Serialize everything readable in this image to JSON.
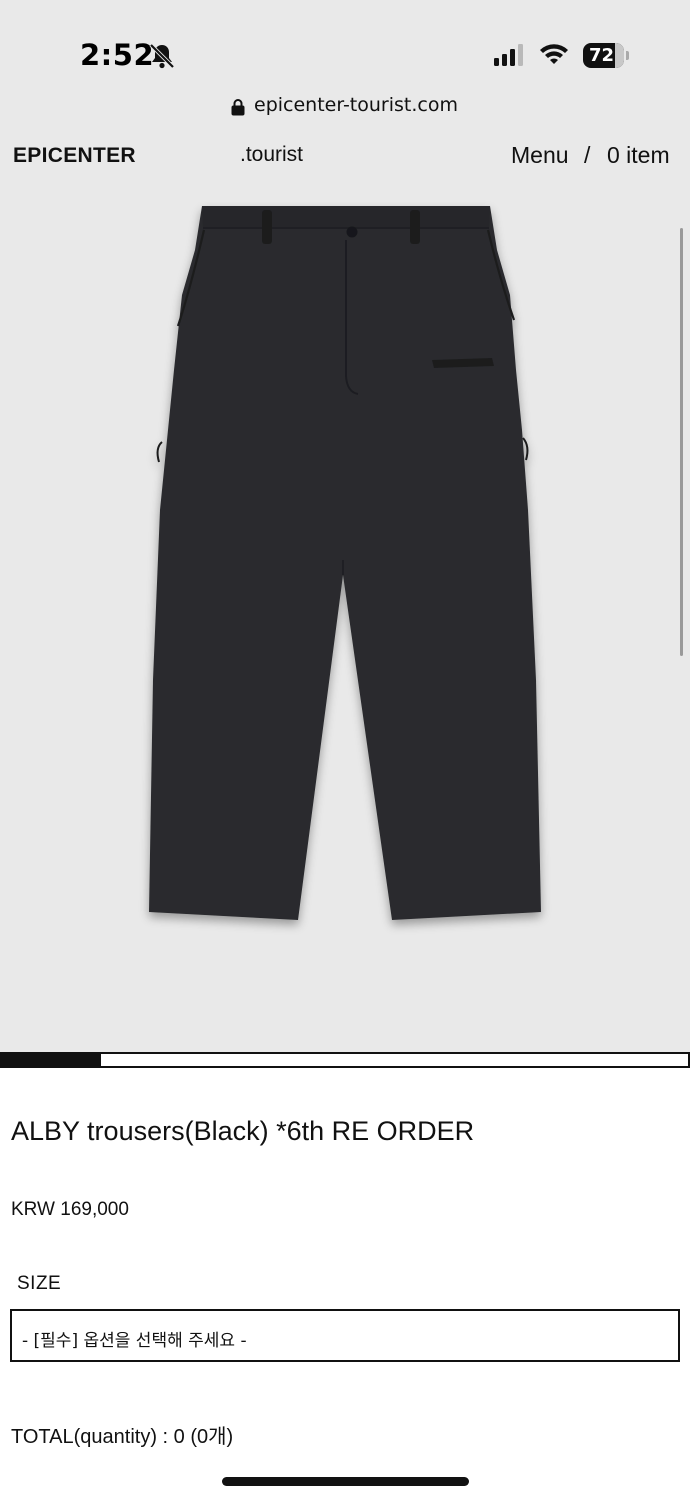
{
  "status_bar": {
    "time": "2:52",
    "battery_level": "72",
    "icons": [
      "bell-slash-icon",
      "cellular-signal-icon",
      "wifi-icon",
      "battery-icon"
    ]
  },
  "browser": {
    "url": "epicenter-tourist.com"
  },
  "header": {
    "logo": "EPICENTER",
    "sub_logo": ".tourist",
    "menu_label": "Menu",
    "separator": "/",
    "cart_label": "0 item"
  },
  "gallery": {
    "progress_fraction": 0.145,
    "background_color": "#e9e9e9"
  },
  "product": {
    "title": "ALBY trousers(Black) *6th RE ORDER",
    "price": "KRW 169,000",
    "size_label": "SIZE",
    "size_select_value": "- [필수] 옵션을 선택해 주세요 -",
    "total": "TOTAL(quantity) : 0 (0개)"
  },
  "colors": {
    "garment": "#2a2b2e",
    "text": "#111111",
    "page_bg": "#ffffff"
  }
}
